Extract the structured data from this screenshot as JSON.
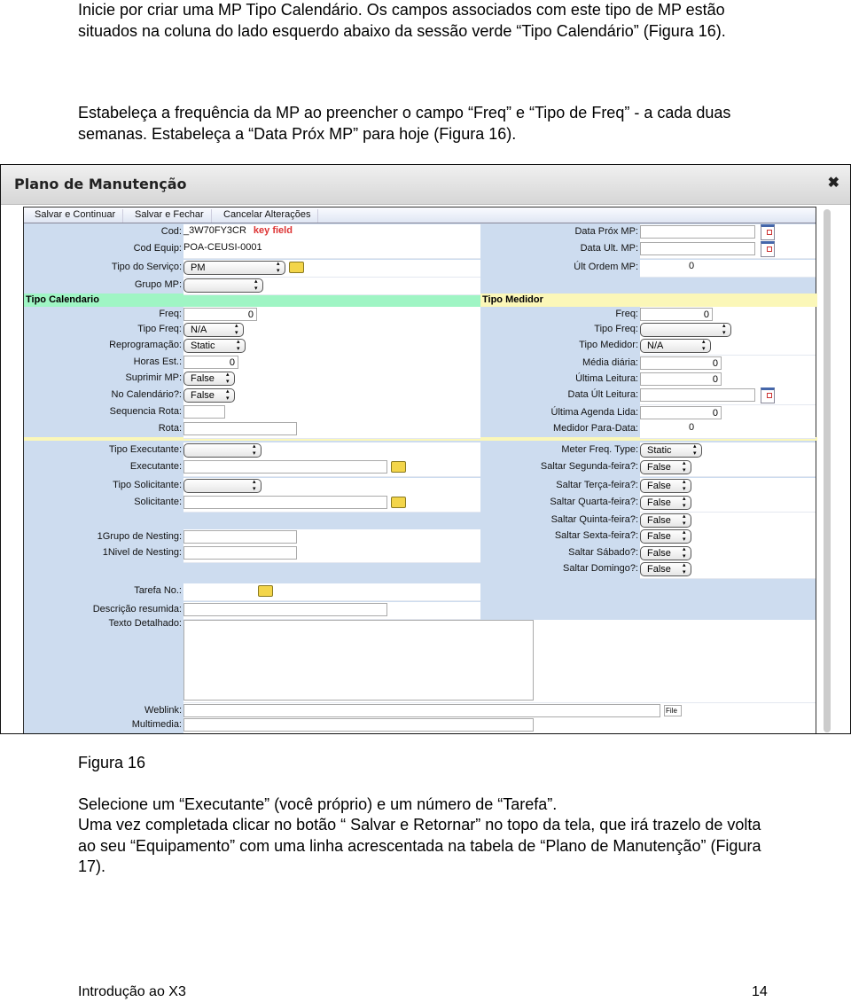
{
  "doc": {
    "para1": "Inicie por criar uma MP Tipo Calendário. Os campos associados com este tipo de MP estão situados na coluna do lado esquerdo abaixo da sessão verde “Tipo Calendário” (Figura 16).",
    "para2": "Estabeleça a frequência da MP ao preencher o campo “Freq” e “Tipo de Freq” - a cada duas semanas. Estabeleça a “Data Próx MP” para hoje (Figura 16).",
    "caption": "Figura 16",
    "para3": "Selecione um “Executante” (você próprio) e um número de “Tarefa”.",
    "para4": "Uma vez completada clicar no botão “ Salvar e Retornar” no topo da tela, que irá trazelo de volta ao seu “Equipamento” com uma linha acrescentada na tabela de “Plano de Manutenção” (Figura 17).",
    "footer_left": "Introdução ao X3",
    "footer_page": "14"
  },
  "window": {
    "title": "Plano de Manutenção",
    "close_icon": "close-icon"
  },
  "toolbar": [
    "Salvar e Continuar",
    "Salvar e Fechar",
    "Cancelar Alterações"
  ],
  "sections": {
    "left": "Tipo Calendario",
    "right": "Tipo Medidor",
    "left_color": "#9ff5c4",
    "right_color": "#fbf7b8"
  },
  "key_field_note": "key field",
  "left_fields": [
    {
      "label": "Cod:",
      "value": "_3W70FY3CR",
      "type": "static"
    },
    {
      "label": "Cod Equip:",
      "value": "POA-CEUSI-0001",
      "type": "static"
    },
    {
      "label": "Tipo do Serviço:",
      "value": "PM",
      "type": "select",
      "icon": "folder-icon"
    },
    {
      "label": "Grupo MP:",
      "value": "",
      "type": "select"
    },
    {
      "label": "Freq:",
      "value": "0",
      "type": "number"
    },
    {
      "label": "Tipo Freq:",
      "value": "N/A",
      "type": "select"
    },
    {
      "label": "Reprogramação:",
      "value": "Static",
      "type": "select"
    },
    {
      "label": "Horas Est.:",
      "value": "0",
      "type": "number"
    },
    {
      "label": "Suprimir MP:",
      "value": "False",
      "type": "select"
    },
    {
      "label": "No Calendário?:",
      "value": "False",
      "type": "select"
    },
    {
      "label": "Sequencia Rota:",
      "value": "",
      "type": "text"
    },
    {
      "label": "Rota:",
      "value": "",
      "type": "text"
    },
    {
      "label": "Tipo Executante:",
      "value": "",
      "type": "select"
    },
    {
      "label": "Executante:",
      "value": "",
      "type": "text",
      "icon": "folder-icon"
    },
    {
      "label": "Tipo Solicitante:",
      "value": "",
      "type": "select"
    },
    {
      "label": "Solicitante:",
      "value": "",
      "type": "text",
      "icon": "folder-icon"
    },
    {
      "label": "1Grupo de Nesting:",
      "value": "",
      "type": "text"
    },
    {
      "label": "1Nivel de Nesting:",
      "value": "",
      "type": "text"
    },
    {
      "label": "Tarefa No.:",
      "value": "",
      "type": "static",
      "icon": "folder-icon"
    },
    {
      "label": "Descrição resumida:",
      "value": "",
      "type": "text"
    },
    {
      "label": "Texto Detalhado:",
      "value": "",
      "type": "textarea"
    },
    {
      "label": "Weblink:",
      "value": "",
      "type": "text",
      "button": "File"
    },
    {
      "label": "Multimedia:",
      "value": "",
      "type": "text"
    }
  ],
  "right_fields": [
    {
      "label": "Data Próx MP:",
      "value": "",
      "type": "text",
      "icon": "calendar-icon"
    },
    {
      "label": "Data Ult. MP:",
      "value": "",
      "type": "text",
      "icon": "calendar-icon"
    },
    {
      "label": "Últ Ordem MP:",
      "value": "0",
      "type": "static"
    },
    {
      "label": "Freq:",
      "value": "0",
      "type": "number"
    },
    {
      "label": "Tipo Freq:",
      "value": "",
      "type": "select"
    },
    {
      "label": "Tipo Medidor:",
      "value": "N/A",
      "type": "select"
    },
    {
      "label": "Média diária:",
      "value": "0",
      "type": "number"
    },
    {
      "label": "Última Leitura:",
      "value": "0",
      "type": "number"
    },
    {
      "label": "Data Últ Leitura:",
      "value": "",
      "type": "text",
      "icon": "calendar-icon"
    },
    {
      "label": "Última Agenda Lida:",
      "value": "0",
      "type": "number"
    },
    {
      "label": "Medidor Para-Data:",
      "value": "0",
      "type": "static"
    },
    {
      "label": "Meter Freq. Type:",
      "value": "Static",
      "type": "select"
    },
    {
      "label": "Saltar Segunda-feira?:",
      "value": "False",
      "type": "select"
    },
    {
      "label": "Saltar Terça-feira?:",
      "value": "False",
      "type": "select"
    },
    {
      "label": "Saltar Quarta-feira?:",
      "value": "False",
      "type": "select"
    },
    {
      "label": "Saltar Quinta-feira?:",
      "value": "False",
      "type": "select"
    },
    {
      "label": "Saltar Sexta-feira?:",
      "value": "False",
      "type": "select"
    },
    {
      "label": "Saltar Sábado?:",
      "value": "False",
      "type": "select"
    },
    {
      "label": "Saltar Domingo?:",
      "value": "False",
      "type": "select"
    }
  ]
}
